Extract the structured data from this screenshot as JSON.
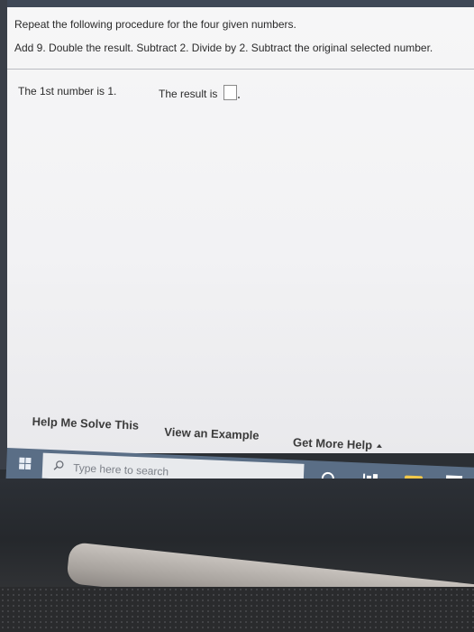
{
  "problem": {
    "instruction": "Repeat the following procedure for the four given numbers.",
    "procedure": "Add 9. Double the result. Subtract 2. Divide by 2. Subtract the original selected number.",
    "number_text": "The 1st number is 1.",
    "result_label": "The result is",
    "answer_value": ""
  },
  "help": {
    "solve_label": "Help Me Solve This",
    "example_label": "View an Example",
    "more_label": "Get More Help"
  },
  "taskbar": {
    "search_placeholder": "Type here to search"
  }
}
